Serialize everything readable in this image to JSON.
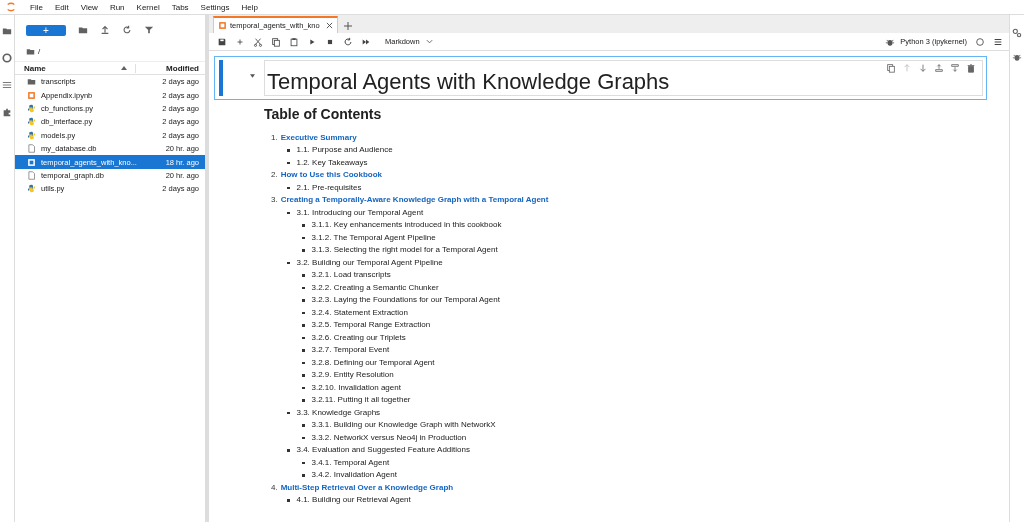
{
  "menu": [
    "File",
    "Edit",
    "View",
    "Run",
    "Kernel",
    "Tabs",
    "Settings",
    "Help"
  ],
  "file_browser": {
    "new_button": "+",
    "path": "/",
    "columns": [
      "Name",
      "Modified"
    ],
    "files": [
      {
        "name": "transcripts",
        "kind": "folder",
        "modified": "2 days ago",
        "selected": false
      },
      {
        "name": "Appendix.ipynb",
        "kind": "notebook",
        "modified": "2 days ago",
        "selected": false
      },
      {
        "name": "cb_functions.py",
        "kind": "python",
        "modified": "2 days ago",
        "selected": false
      },
      {
        "name": "db_interface.py",
        "kind": "python",
        "modified": "2 days ago",
        "selected": false
      },
      {
        "name": "models.py",
        "kind": "python",
        "modified": "2 days ago",
        "selected": false
      },
      {
        "name": "my_database.db",
        "kind": "file",
        "modified": "20 hr. ago",
        "selected": false
      },
      {
        "name": "temporal_agents_with_kno...",
        "kind": "notebook",
        "modified": "18 hr. ago",
        "selected": true
      },
      {
        "name": "temporal_graph.db",
        "kind": "file",
        "modified": "20 hr. ago",
        "selected": false
      },
      {
        "name": "utils.py",
        "kind": "python",
        "modified": "2 days ago",
        "selected": false
      }
    ]
  },
  "tabs": [
    {
      "label": "temporal_agents_with_kno",
      "selected": true
    }
  ],
  "toolbar": {
    "cell_type": "Markdown",
    "kernel": "Python 3 (ipykernel)"
  },
  "notebook": {
    "title": "Temporal Agents with Knowledge Graphs",
    "toc_heading": "Table of Contents",
    "toc": [
      {
        "number": "1.",
        "title": "Executive Summary",
        "children": [
          {
            "text": "1.1. Purpose and Audience"
          },
          {
            "text": "1.2. Key Takeaways"
          }
        ]
      },
      {
        "number": "2.",
        "title": "How to Use this Cookbook",
        "children": [
          {
            "text": "2.1. Pre-requisites"
          }
        ]
      },
      {
        "number": "3.",
        "title": "Creating a Temporally-Aware Knowledge Graph with a Temporal Agent",
        "children": [
          {
            "text": "3.1. Introducing our Temporal Agent",
            "children": [
              {
                "text": "3.1.1. Key enhancements introduced in this cookbook"
              },
              {
                "text": "3.1.2. The Temporal Agent Pipeline"
              },
              {
                "text": "3.1.3. Selecting the right model for a Temporal Agent"
              }
            ]
          },
          {
            "text": "3.2. Building our Temporal Agent Pipeline",
            "children": [
              {
                "text": "3.2.1. Load transcripts"
              },
              {
                "text": "3.2.2. Creating a Semantic Chunker"
              },
              {
                "text": "3.2.3. Laying the Foundations for our Temporal Agent"
              },
              {
                "text": "3.2.4. Statement Extraction"
              },
              {
                "text": "3.2.5. Temporal Range Extraction"
              },
              {
                "text": "3.2.6. Creating our Triplets"
              },
              {
                "text": "3.2.7. Temporal Event"
              },
              {
                "text": "3.2.8. Defining our Temporal Agent"
              },
              {
                "text": "3.2.9. Entity Resolution"
              },
              {
                "text": "3.2.10. Invalidation agent"
              },
              {
                "text": "3.2.11. Putting it all together"
              }
            ]
          },
          {
            "text": "3.3. Knowledge Graphs",
            "children": [
              {
                "text": "3.3.1. Building our Knowledge Graph with NetworkX"
              },
              {
                "text": "3.3.2. NetworkX versus Neo4j in Production"
              }
            ]
          },
          {
            "text": "3.4. Evaluation and Suggested Feature Additions",
            "children": [
              {
                "text": "3.4.1. Temporal Agent"
              },
              {
                "text": "3.4.2. Invalidation Agent"
              }
            ]
          }
        ]
      },
      {
        "number": "4.",
        "title": "Multi-Step Retrieval Over a Knowledge Graph",
        "children": [
          {
            "text": "4.1. Building our Retrieval Agent"
          }
        ]
      }
    ]
  }
}
